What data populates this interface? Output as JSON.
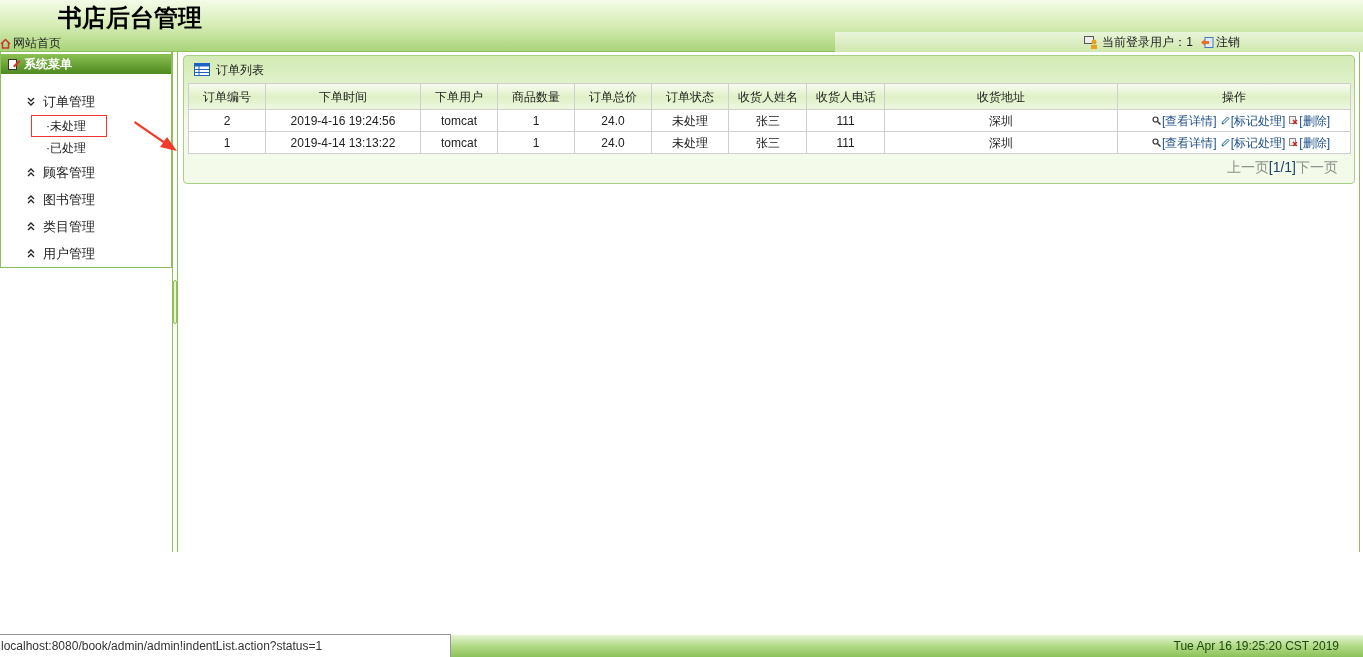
{
  "header": {
    "title": "书店后台管理",
    "home_link": "网站首页",
    "user_label": "当前登录用户：1",
    "logout": "注销"
  },
  "sidebar": {
    "title": "系统菜单",
    "groups": [
      {
        "label": "订单管理",
        "expanded": true,
        "children": [
          {
            "label": "·未处理",
            "highlighted": true
          },
          {
            "label": "·已处理",
            "highlighted": false
          }
        ]
      },
      {
        "label": "顾客管理",
        "expanded": false
      },
      {
        "label": "图书管理",
        "expanded": false
      },
      {
        "label": "类目管理",
        "expanded": false
      },
      {
        "label": "用户管理",
        "expanded": false
      }
    ]
  },
  "annotation": {
    "arrow": true
  },
  "panel": {
    "title": "订单列表",
    "table": {
      "columns": [
        "订单编号",
        "下单时间",
        "下单用户",
        "商品数量",
        "订单总价",
        "订单状态",
        "收货人姓名",
        "收货人电话",
        "收货地址",
        "操作"
      ],
      "rows": [
        {
          "cells": [
            "2",
            "2019-4-16 19:24:56",
            "tomcat",
            "1",
            "24.0",
            "未处理",
            "张三",
            "111",
            "深圳"
          ],
          "actions": [
            "[查看详情]",
            "[标记处理]",
            "[删除]"
          ]
        },
        {
          "cells": [
            "1",
            "2019-4-14 13:13:22",
            "tomcat",
            "1",
            "24.0",
            "未处理",
            "张三",
            "111",
            "深圳"
          ],
          "actions": [
            "[查看详情]",
            "[标记处理]",
            "[删除]"
          ]
        }
      ]
    },
    "pagination": {
      "prev": "上一页",
      "page": "[1/1]",
      "next": "下一页"
    }
  },
  "status_bar": {
    "url": "localhost:8080/book/admin/admin!indentList.action?status=1",
    "datetime": "Tue Apr 16 19:25:20 CST 2019"
  }
}
